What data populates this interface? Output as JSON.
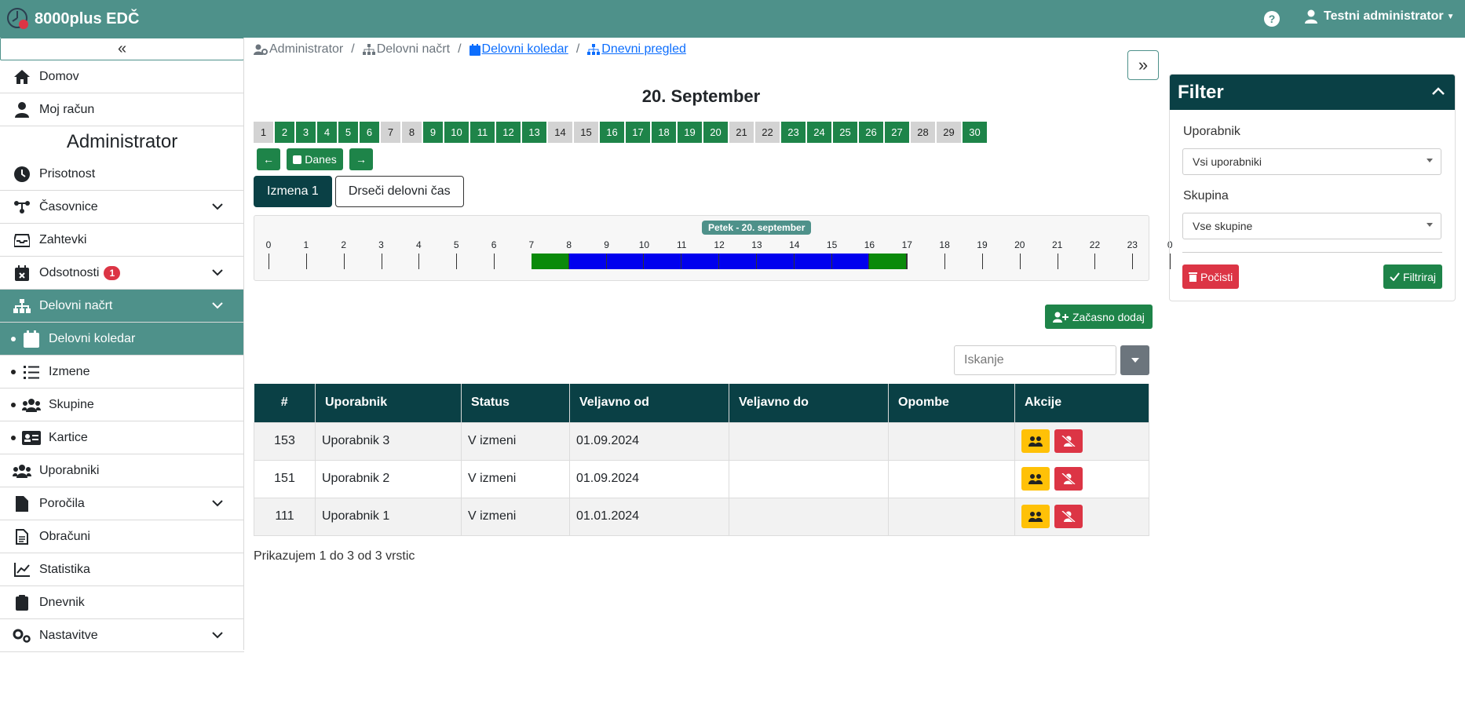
{
  "app": {
    "title": "8000plus EDČ",
    "user_name": "Testni administrator",
    "help_label": "?"
  },
  "sidebar": {
    "collapse_label": "«",
    "items": [
      {
        "label": "Domov",
        "icon": "home-icon"
      },
      {
        "label": "Moj račun",
        "icon": "user-icon"
      }
    ],
    "section_title": "Administrator",
    "admin_items": [
      {
        "label": "Prisotnost",
        "icon": "clock-icon"
      },
      {
        "label": "Časovnice",
        "icon": "timeline-icon",
        "expandable": true
      },
      {
        "label": "Zahtevki",
        "icon": "inbox-icon"
      },
      {
        "label": "Odsotnosti",
        "icon": "calendar-x-icon",
        "badge": "1",
        "expandable": true
      },
      {
        "label": "Delovni načrt",
        "icon": "sitemap-icon",
        "expandable": true,
        "active": true
      },
      {
        "label": "Delovni koledar",
        "icon": "calendar-icon",
        "sub": true,
        "active": true
      },
      {
        "label": "Izmene",
        "icon": "list-icon",
        "sub": true
      },
      {
        "label": "Skupine",
        "icon": "users-icon",
        "sub": true
      },
      {
        "label": "Kartice",
        "icon": "id-card-icon",
        "sub": true
      },
      {
        "label": "Uporabniki",
        "icon": "users-icon"
      },
      {
        "label": "Poročila",
        "icon": "file-icon",
        "expandable": true
      },
      {
        "label": "Obračuni",
        "icon": "file-text-icon"
      },
      {
        "label": "Statistika",
        "icon": "chart-line-icon"
      },
      {
        "label": "Dnevnik",
        "icon": "clipboard-icon"
      },
      {
        "label": "Nastavitve",
        "icon": "gears-icon",
        "expandable": true
      }
    ]
  },
  "breadcrumb": {
    "items": [
      {
        "label": "Administrator",
        "link": false
      },
      {
        "label": "Delovni načrt",
        "link": false
      },
      {
        "label": "Delovni koledar",
        "link": true
      },
      {
        "label": "Dnevni pregled",
        "link": true
      }
    ],
    "separator": "/"
  },
  "expand_label": "»",
  "day_title": "20. September",
  "days": [
    {
      "n": "1",
      "off": true
    },
    {
      "n": "2",
      "off": false
    },
    {
      "n": "3",
      "off": false
    },
    {
      "n": "4",
      "off": false
    },
    {
      "n": "5",
      "off": false
    },
    {
      "n": "6",
      "off": false
    },
    {
      "n": "7",
      "off": true
    },
    {
      "n": "8",
      "off": true
    },
    {
      "n": "9",
      "off": false
    },
    {
      "n": "10",
      "off": false
    },
    {
      "n": "11",
      "off": false
    },
    {
      "n": "12",
      "off": false
    },
    {
      "n": "13",
      "off": false
    },
    {
      "n": "14",
      "off": true
    },
    {
      "n": "15",
      "off": true
    },
    {
      "n": "16",
      "off": false
    },
    {
      "n": "17",
      "off": false
    },
    {
      "n": "18",
      "off": false
    },
    {
      "n": "19",
      "off": false
    },
    {
      "n": "20",
      "off": false
    },
    {
      "n": "21",
      "off": true
    },
    {
      "n": "22",
      "off": true
    },
    {
      "n": "23",
      "off": false
    },
    {
      "n": "24",
      "off": false
    },
    {
      "n": "25",
      "off": false
    },
    {
      "n": "26",
      "off": false
    },
    {
      "n": "27",
      "off": false
    },
    {
      "n": "28",
      "off": true
    },
    {
      "n": "29",
      "off": true
    },
    {
      "n": "30",
      "off": false
    }
  ],
  "nav": {
    "prev": "←",
    "today": "Danes",
    "next": "→"
  },
  "tabs": [
    {
      "label": "Izmena 1",
      "selected": true
    },
    {
      "label": "Drseči delovni čas",
      "selected": false
    }
  ],
  "timeline": {
    "label": "Petek - 20. september",
    "hours": [
      "0",
      "1",
      "2",
      "3",
      "4",
      "5",
      "6",
      "7",
      "8",
      "9",
      "10",
      "11",
      "12",
      "13",
      "14",
      "15",
      "16",
      "17",
      "18",
      "19",
      "20",
      "21",
      "22",
      "23",
      "0"
    ],
    "segments": [
      {
        "from": 7,
        "to": 8,
        "color": "#0a8a0a"
      },
      {
        "from": 8,
        "to": 16,
        "color": "#0000ee"
      },
      {
        "from": 16,
        "to": 17,
        "color": "#0a8a0a"
      }
    ]
  },
  "add_button": "Začasno dodaj",
  "search": {
    "placeholder": "Iskanje"
  },
  "table": {
    "columns": [
      "#",
      "Uporabnik",
      "Status",
      "Veljavno od",
      "Veljavno do",
      "Opombe",
      "Akcije"
    ],
    "rows": [
      {
        "id": "153",
        "user": "Uporabnik 3",
        "status": "V izmeni",
        "from": "01.09.2024",
        "to": "",
        "note": ""
      },
      {
        "id": "151",
        "user": "Uporabnik 2",
        "status": "V izmeni",
        "from": "01.09.2024",
        "to": "",
        "note": ""
      },
      {
        "id": "111",
        "user": "Uporabnik 1",
        "status": "V izmeni",
        "from": "01.01.2024",
        "to": "",
        "note": ""
      }
    ]
  },
  "table_info": "Prikazujem 1 do 3 od 3 vrstic",
  "filter": {
    "title": "Filter",
    "user_label": "Uporabnik",
    "user_value": "Vsi uporabniki",
    "group_label": "Skupina",
    "group_value": "Vse skupine",
    "clear_label": "Počisti",
    "apply_label": "Filtriraj"
  },
  "colors": {
    "primary": "#4e918a",
    "dark": "#0a4045",
    "green": "#1e8449",
    "danger": "#dc3545",
    "warning": "#ffc107"
  }
}
